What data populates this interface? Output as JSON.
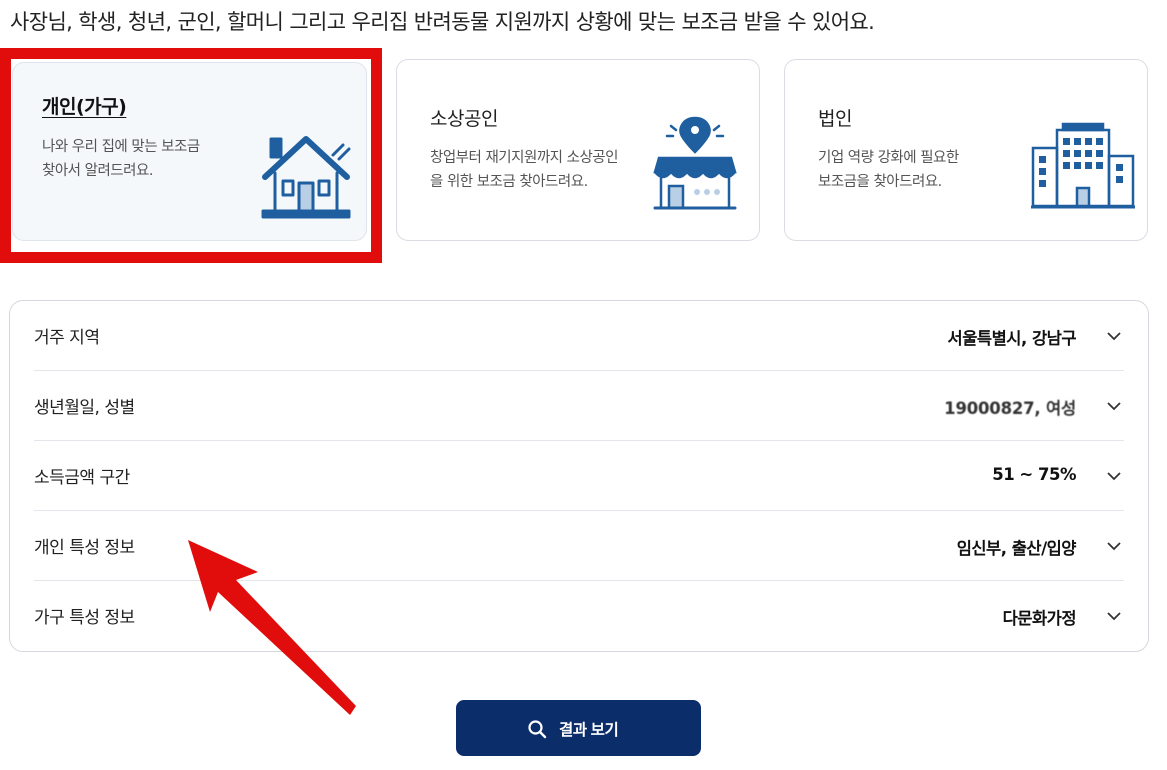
{
  "headline": "사장님, 학생, 청년, 군인, 할머니 그리고 우리집 반려동물 지원까지 상황에 맞는 보조금 받을 수 있어요.",
  "categories": [
    {
      "title": "개인(가구)",
      "desc_line1": "나와 우리 집에 맞는 보조금",
      "desc_line2": "찾아서 알려드려요.",
      "icon": "house-icon",
      "selected": true
    },
    {
      "title": "소상공인",
      "desc_line1": "창업부터 재기지원까지 소상공인",
      "desc_line2": "을 위한 보조금 찾아드려요.",
      "icon": "store-icon",
      "selected": false
    },
    {
      "title": "법인",
      "desc_line1": "기업 역량 강화에 필요한",
      "desc_line2": "보조금을 찾아드려요.",
      "icon": "building-icon",
      "selected": false
    }
  ],
  "filters": [
    {
      "label": "거주 지역",
      "value": "서울특별시, 강남구"
    },
    {
      "label": "생년월일, 성별",
      "value": "19000827, 여성"
    },
    {
      "label": "소득금액 구간",
      "value": "51 ~ 75%"
    },
    {
      "label": "개인 특성 정보",
      "value": "임신부, 출산/입양"
    },
    {
      "label": "가구 특성 정보",
      "value": "다문화가정"
    }
  ],
  "result_button": {
    "label": "결과 보기",
    "icon": "search-icon"
  },
  "colors": {
    "brand_navy": "#0b2d6a",
    "icon_blue": "#1f5fa0",
    "annotation_red": "#e10d0d",
    "selected_card_bg": "#f4f8fb"
  }
}
